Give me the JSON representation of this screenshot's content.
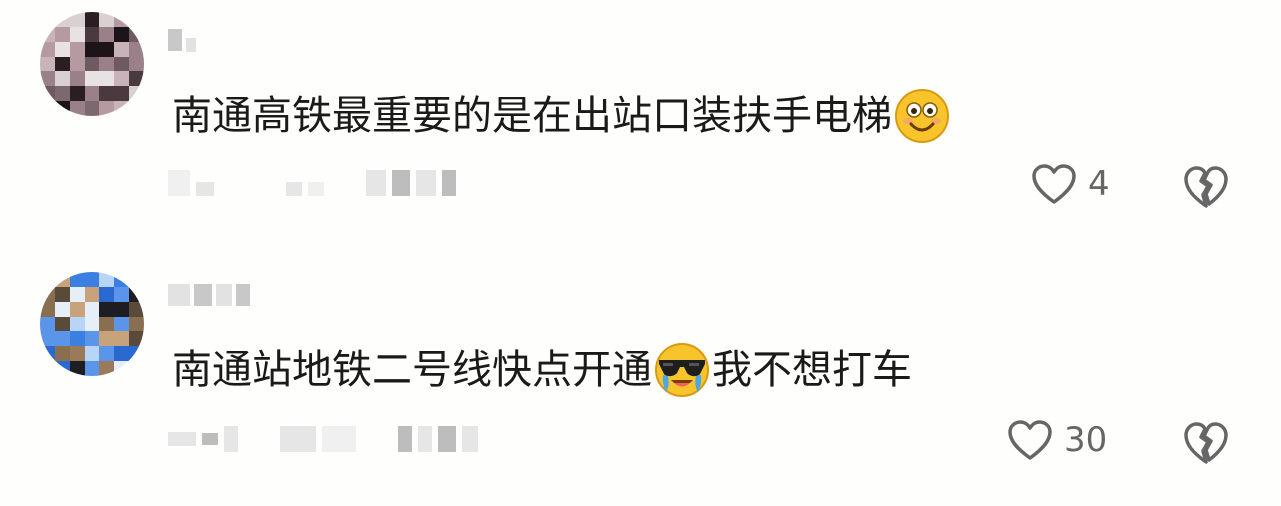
{
  "comments": [
    {
      "text_before": "南通高铁最重要的是在出站口装扶手电梯",
      "emoji": "smiley-face-emoji",
      "text_after": "",
      "like_count": "4"
    },
    {
      "text_before": "南通站地铁二号线快点开通",
      "emoji": "cool-sunglasses-tears-emoji",
      "text_after": "我不想打车",
      "like_count": "30"
    }
  ],
  "icons": {
    "like": "heart-outline-icon",
    "dislike": "broken-heart-icon"
  },
  "colors": {
    "background": "#fefefc",
    "text": "#1a1a1a",
    "icon": "#666666",
    "emoji_yellow": "#f7c52b"
  }
}
